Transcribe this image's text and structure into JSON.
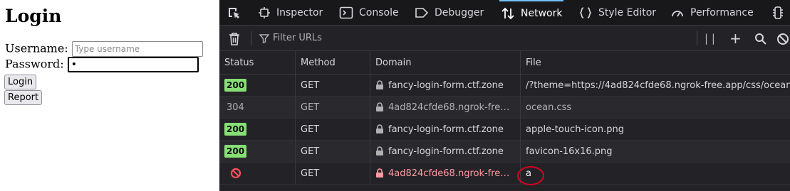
{
  "login": {
    "title": "Login",
    "username_label": "Username:",
    "username_placeholder": "Type username",
    "password_label": "Password:",
    "password_value": "•",
    "login_button": "Login",
    "report_button": "Report"
  },
  "devtools": {
    "tabs": [
      {
        "label": "Inspector",
        "icon": "inspector-icon"
      },
      {
        "label": "Console",
        "icon": "console-icon"
      },
      {
        "label": "Debugger",
        "icon": "debugger-icon"
      },
      {
        "label": "Network",
        "icon": "network-icon",
        "active": true
      },
      {
        "label": "Style Editor",
        "icon": "style-editor-icon"
      },
      {
        "label": "Performance",
        "icon": "performance-icon"
      }
    ],
    "toolbar": {
      "filter_placeholder": "Filter URLs",
      "pause_glyph": "| |",
      "plus_glyph": "+"
    },
    "columns": {
      "status": "Status",
      "method": "Method",
      "domain": "Domain",
      "file": "File"
    },
    "requests": [
      {
        "status": "200",
        "status_type": "ok",
        "method": "GET",
        "domain": "fancy-login-form.ctf.zone",
        "file": "/?theme=https://4ad824cfde68.ngrok-free.app/css/ocean"
      },
      {
        "status": "304",
        "status_type": "cached",
        "method": "GET",
        "domain": "4ad824cfde68.ngrok-fre…",
        "file": "ocean.css"
      },
      {
        "status": "200",
        "status_type": "ok",
        "method": "GET",
        "domain": "fancy-login-form.ctf.zone",
        "file": "apple-touch-icon.png"
      },
      {
        "status": "200",
        "status_type": "ok",
        "method": "GET",
        "domain": "fancy-login-form.ctf.zone",
        "file": "favicon-16x16.png"
      },
      {
        "status": "",
        "status_type": "blocked",
        "method": "GET",
        "domain": "4ad824cfde68.ngrok-fre…",
        "file": "a"
      }
    ],
    "colors": {
      "ok_badge": "#86de74",
      "blocked": "#ff4f5e",
      "active_tab": "#75bfff",
      "annotation": "#d70022"
    }
  }
}
